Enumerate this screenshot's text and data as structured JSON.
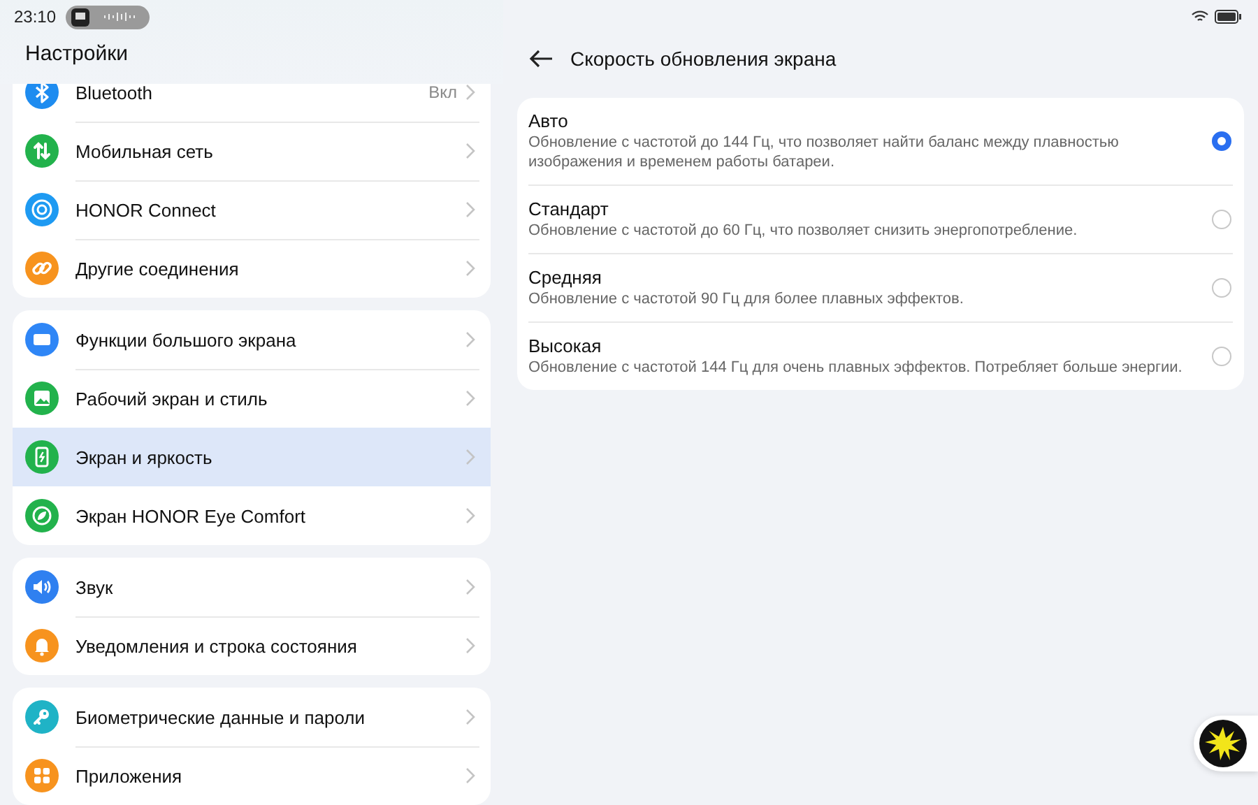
{
  "status_bar": {
    "time": "23:10"
  },
  "settings": {
    "title": "Настройки",
    "groups": [
      {
        "items": [
          {
            "kind": "bluetooth",
            "label": "Bluetooth",
            "value": "Вкл",
            "color": "#1e8cf0",
            "selected": false
          },
          {
            "kind": "mobile",
            "label": "Мобильная сеть",
            "color": "#22b24c",
            "selected": false
          },
          {
            "kind": "connect",
            "label": "HONOR Connect",
            "color": "#1e9af2",
            "selected": false
          },
          {
            "kind": "link",
            "label": "Другие соединения",
            "color": "#f7931e",
            "selected": false
          }
        ]
      },
      {
        "items": [
          {
            "kind": "screen",
            "label": "Функции большого экрана",
            "color": "#2f86f6",
            "selected": false
          },
          {
            "kind": "wallpaper",
            "label": "Рабочий экран и стиль",
            "color": "#22b24c",
            "selected": false
          },
          {
            "kind": "display",
            "label": "Экран и яркость",
            "color": "#22b24c",
            "selected": true
          },
          {
            "kind": "eye",
            "label": "Экран HONOR Eye Comfort",
            "color": "#22b24c",
            "selected": false
          }
        ]
      },
      {
        "items": [
          {
            "kind": "sound",
            "label": "Звук",
            "color": "#2f80f0",
            "selected": false
          },
          {
            "kind": "bell",
            "label": "Уведомления и строка состояния",
            "color": "#f7931e",
            "selected": false
          }
        ]
      },
      {
        "items": [
          {
            "kind": "key",
            "label": "Биометрические данные и пароли",
            "color": "#1fb3c6",
            "selected": false
          },
          {
            "kind": "apps",
            "label": "Приложения",
            "color": "#f7931e",
            "selected": false
          }
        ]
      }
    ]
  },
  "detail": {
    "title": "Скорость обновления экрана",
    "options": [
      {
        "title": "Авто",
        "description": "Обновление с частотой до 144 Гц, что позволяет найти баланс между плавностью изображения и временем работы батареи.",
        "selected": true
      },
      {
        "title": "Стандарт",
        "description": "Обновление с частотой до 60 Гц, что позволяет снизить энергопотребление.",
        "selected": false
      },
      {
        "title": "Средняя",
        "description": "Обновление с частотой 90 Гц для более плавных эффектов.",
        "selected": false
      },
      {
        "title": "Высокая",
        "description": "Обновление с частотой 144 Гц для очень плавных эффектов. Потребляет больше энергии.",
        "selected": false
      }
    ]
  }
}
